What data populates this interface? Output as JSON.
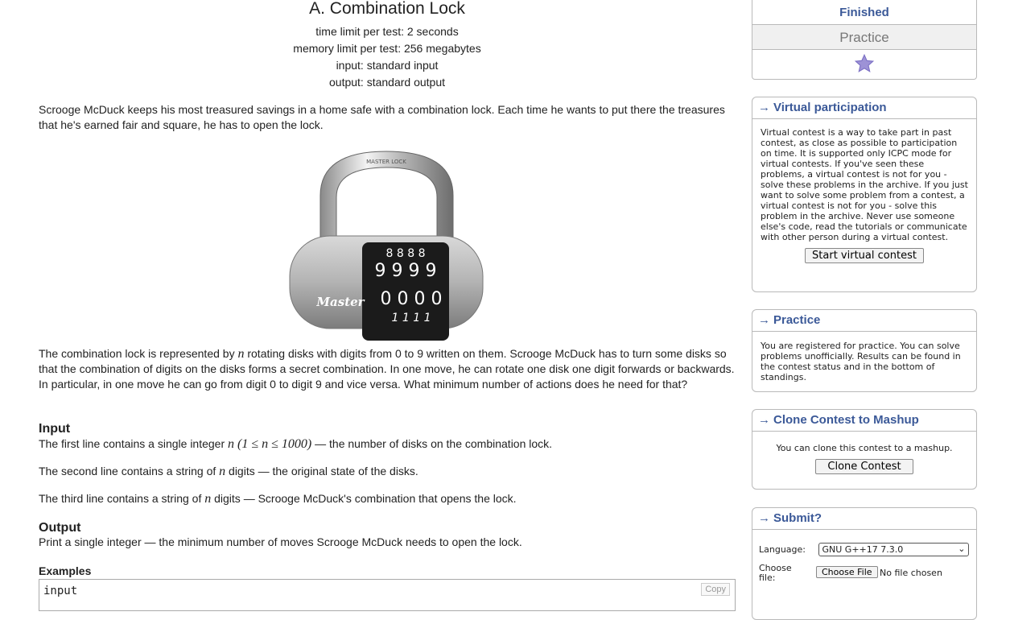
{
  "problem": {
    "title": "A. Combination Lock",
    "limits": [
      "time limit per test: 2 seconds",
      "memory limit per test: 256 megabytes",
      "input: standard input",
      "output: standard output"
    ],
    "legend_1": "Scrooge McDuck keeps his most treasured savings in a home safe with a combination lock. Each time he wants to put there the treasures that he's earned fair and square, he has to open the lock.",
    "image": {
      "brand": "Master",
      "top_word": "MASTER LOCK",
      "rows": [
        "8 8 8 8",
        "9 9 9 9",
        "0 0 0 0",
        "1 1 1 1"
      ]
    },
    "legend_2_a": "The combination lock is represented by ",
    "legend_2_var": "n",
    "legend_2_b": " rotating disks with digits from 0 to 9 written on them. Scrooge McDuck has to turn some disks so that the combination of digits on the disks forms a secret combination. In one move, he can rotate one disk one digit forwards or backwards. In particular, in one move he can go from digit 0 to digit 9 and vice versa. What minimum number of actions does he need for that?",
    "input_title": "Input",
    "input_1_a": "The first line contains a single integer ",
    "input_1_math": "n (1 ≤ n ≤ 1000)",
    "input_1_b": " — the number of disks on the combination lock.",
    "input_2_a": "The second line contains a string of ",
    "input_2_b": " digits — the original state of the disks.",
    "input_3_a": "The third line contains a string of ",
    "input_3_b": " digits — Scrooge McDuck's combination that opens the lock.",
    "output_title": "Output",
    "output_text": "Print a single integer — the minimum number of moves Scrooge McDuck needs to open the lock.",
    "examples_title": "Examples",
    "sample_label": "input",
    "copy_label": "Copy"
  },
  "sidebar": {
    "status": {
      "finished": "Finished",
      "practice": "Practice"
    },
    "virtual": {
      "title": "Virtual participation",
      "text": "Virtual contest is a way to take part in past contest, as close as possible to participation on time. It is supported only ICPC mode for virtual contests. If you've seen these problems, a virtual contest is not for you - solve these problems in the archive. If you just want to solve some problem from a contest, a virtual contest is not for you - solve this problem in the archive. Never use someone else's code, read the tutorials or communicate with other person during a virtual contest.",
      "button": "Start virtual contest"
    },
    "practice": {
      "title": "Practice",
      "text": "You are registered for practice. You can solve problems unofficially. Results can be found in the contest status and in the bottom of standings."
    },
    "clone": {
      "title": "Clone Contest to Mashup",
      "text": "You can clone this contest to a mashup.",
      "button": "Clone Contest"
    },
    "submit": {
      "title": "Submit?",
      "language_label": "Language:",
      "language_value": "GNU G++17 7.3.0",
      "file_label": "Choose file:",
      "file_button": "Choose File",
      "file_status": "No file chosen"
    },
    "arrow": "→"
  },
  "colors": {
    "link": "#3b5998",
    "finished": "#3b5998",
    "practice": "#777777",
    "star": "#9d92d6"
  }
}
